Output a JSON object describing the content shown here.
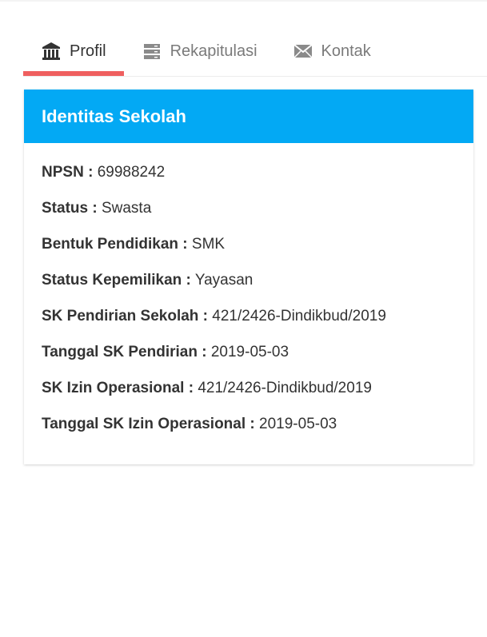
{
  "tabs": [
    {
      "label": "Profil",
      "icon": "bank-icon",
      "active": true
    },
    {
      "label": "Rekapitulasi",
      "icon": "server-icon",
      "active": false
    },
    {
      "label": "Kontak",
      "icon": "envelope-icon",
      "active": false
    }
  ],
  "colors": {
    "header": "#03a9f4",
    "active_tab_underline": "#ef5f5f"
  },
  "card": {
    "title": "Identitas Sekolah",
    "fields": [
      {
        "key": "NPSN :",
        "value": "69988242"
      },
      {
        "key": "Status :",
        "value": "Swasta"
      },
      {
        "key": "Bentuk Pendidikan :",
        "value": "SMK"
      },
      {
        "key": "Status Kepemilikan :",
        "value": "Yayasan"
      },
      {
        "key": "SK Pendirian Sekolah :",
        "value": "421/2426-Dindikbud/2019"
      },
      {
        "key": "Tanggal SK Pendirian :",
        "value": "2019-05-03"
      },
      {
        "key": "SK Izin Operasional :",
        "value": "421/2426-Dindikbud/2019"
      },
      {
        "key": "Tanggal SK Izin Operasional :",
        "value": "2019-05-03"
      }
    ]
  }
}
